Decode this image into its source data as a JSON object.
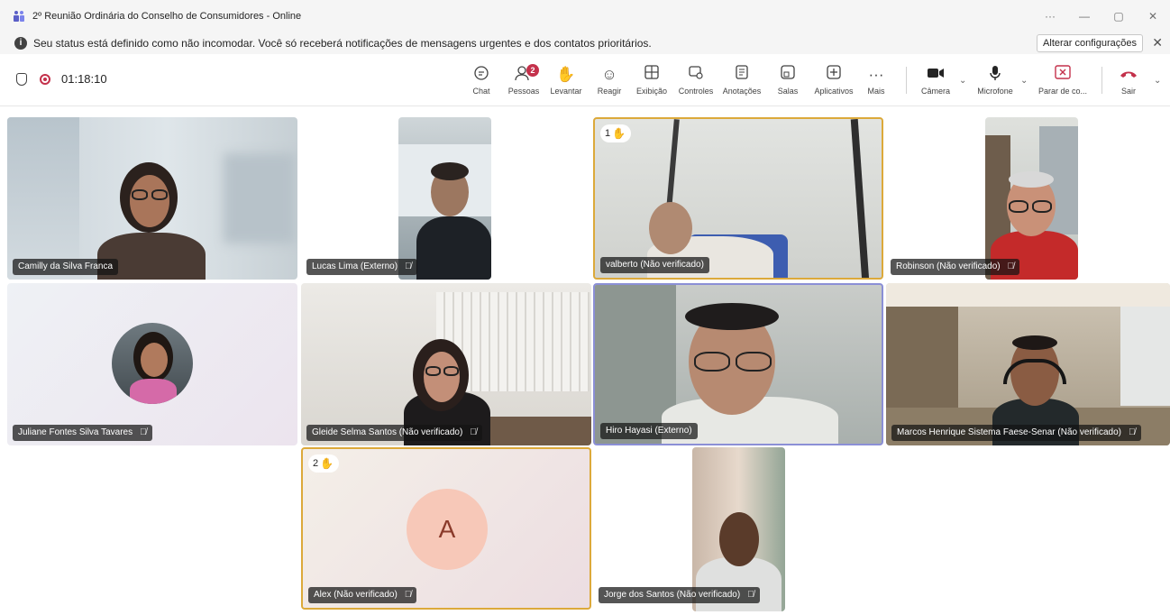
{
  "window": {
    "title": "2º Reunião Ordinária do Conselho de Consumidores - Online",
    "controls": {
      "more": "···",
      "minimize": "—",
      "restore": "▢",
      "close": "✕"
    }
  },
  "banner": {
    "message": "Seu status está definido como não incomodar. Você só receberá notificações de mensagens urgentes e dos contatos prioritários.",
    "settings_button": "Alterar configurações",
    "close": "✕"
  },
  "toolbar": {
    "timer": "01:18:10",
    "people_count": "2",
    "buttons": {
      "chat": "Chat",
      "people": "Pessoas",
      "raise": "Levantar",
      "react": "Reagir",
      "view": "Exibição",
      "controls": "Controles",
      "notes": "Anotações",
      "rooms": "Salas",
      "apps": "Aplicativos",
      "more": "Mais",
      "camera": "Câmera",
      "mic": "Microfone",
      "share": "Parar de co...",
      "leave": "Sair"
    }
  },
  "participants": [
    {
      "name": "Camilly da Silva Franca",
      "muted": false
    },
    {
      "name": "Lucas Lima (Externo)",
      "muted": true
    },
    {
      "name": "valberto (Não verificado)",
      "muted": false,
      "hand": "1"
    },
    {
      "name": "Robinson (Não verificado)",
      "muted": true
    },
    {
      "name": "Juliane Fontes Silva Tavares",
      "muted": true
    },
    {
      "name": "Gleide Selma Santos (Não verificado)",
      "muted": true
    },
    {
      "name": "Hiro Hayasi (Externo)",
      "muted": false
    },
    {
      "name": "Marcos Henrique Sistema Faese-Senar (Não verificado)",
      "muted": true
    },
    {
      "name": "Alex (Não verificado)",
      "muted": true,
      "hand": "2",
      "initial": "A"
    },
    {
      "name": "Jorge dos Santos (Não verificado)",
      "muted": true
    }
  ],
  "colors": {
    "hand_border": "#dca93a",
    "speaker_border": "#8b8fd6",
    "record": "#c4314b",
    "leave": "#c4314b"
  }
}
